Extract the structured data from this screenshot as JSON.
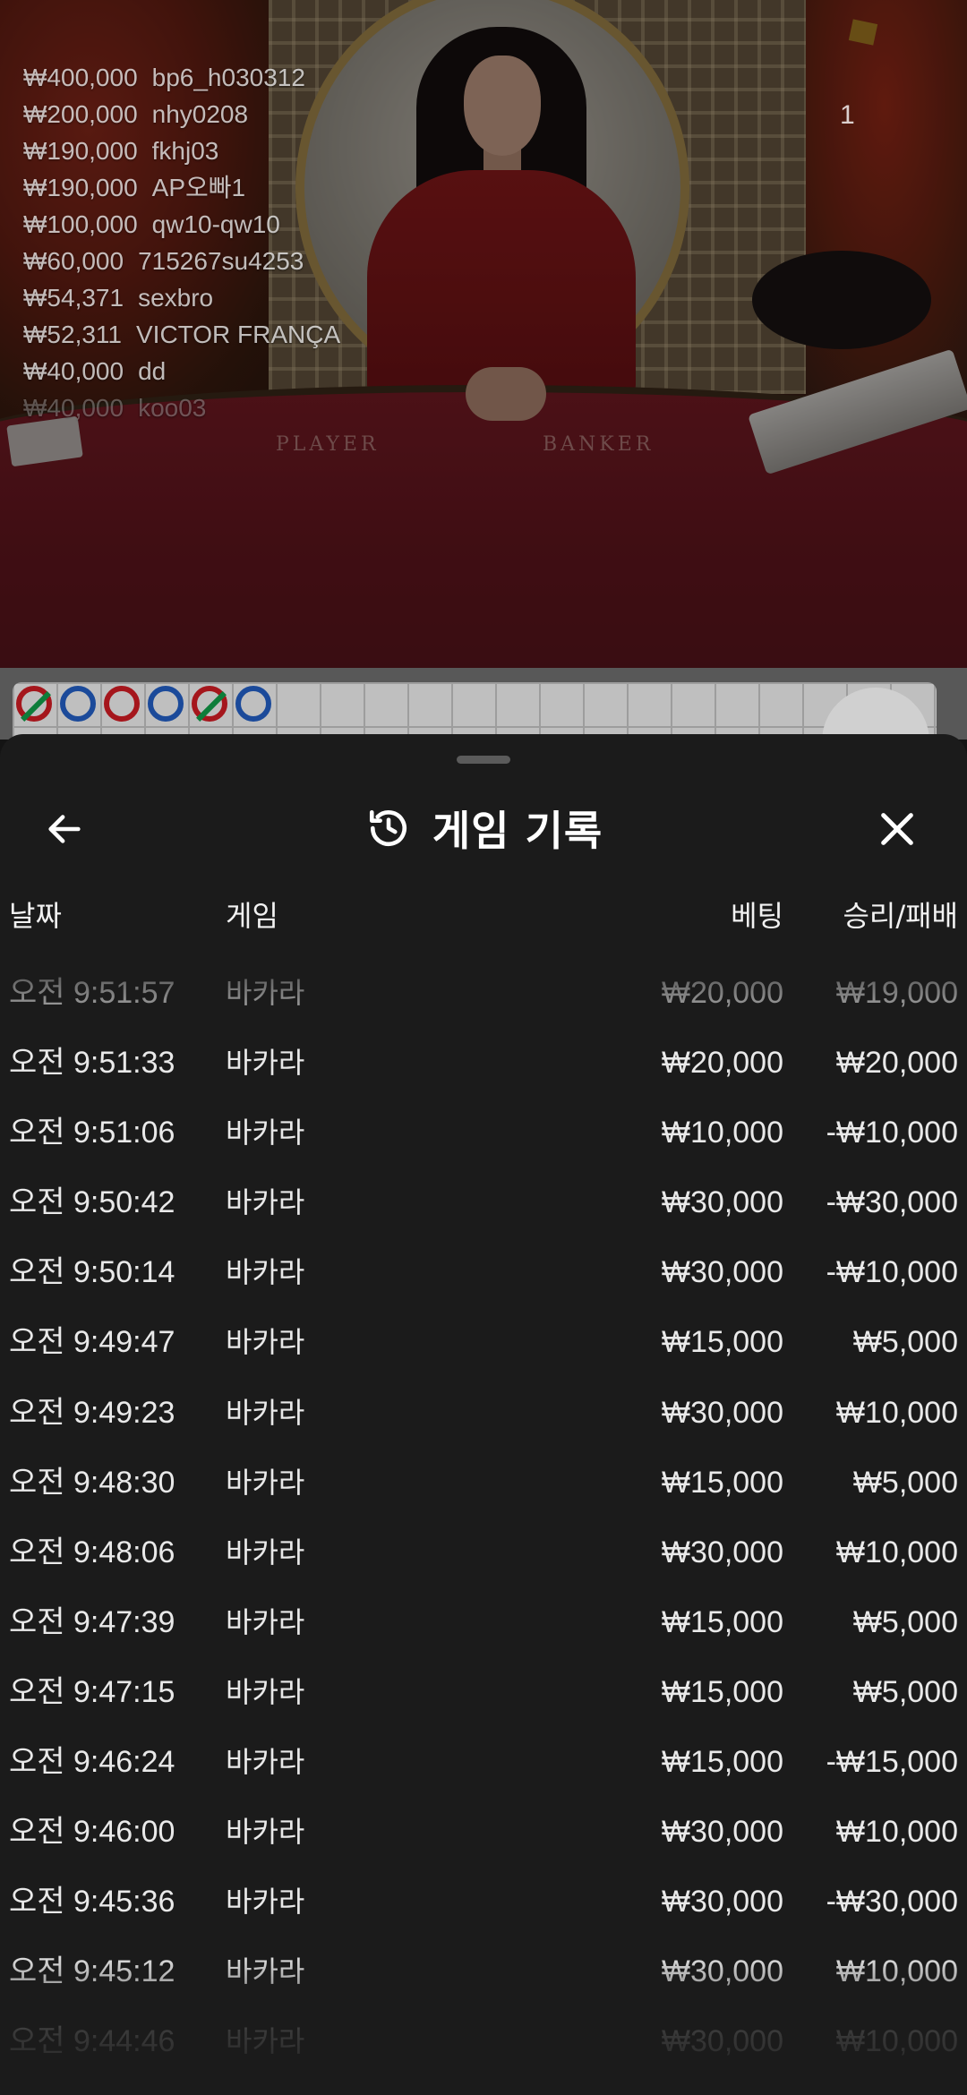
{
  "video": {
    "player_label": "PLAYER",
    "banker_label": "BANKER",
    "counter": "1",
    "top_winners": [
      {
        "amount": "₩400,000",
        "user": "bp6_h030312"
      },
      {
        "amount": "₩200,000",
        "user": "nhy0208"
      },
      {
        "amount": "₩190,000",
        "user": "fkhj03"
      },
      {
        "amount": "₩190,000",
        "user": "AP오빠1"
      },
      {
        "amount": "₩100,000",
        "user": "qw10-qw10"
      },
      {
        "amount": "₩60,000",
        "user": "715267su4253"
      },
      {
        "amount": "₩54,371",
        "user": "sexbro"
      },
      {
        "amount": "₩52,311",
        "user": "VICTOR FRANÇA"
      },
      {
        "amount": "₩40,000",
        "user": "dd"
      },
      {
        "amount": "₩40,000",
        "user": "koo03"
      }
    ]
  },
  "road": {
    "beads": [
      "red-tie",
      "blue",
      "red",
      "blue",
      "red-tie",
      "blue"
    ],
    "colors": {
      "red": "#a5161c",
      "blue": "#1b4a9a",
      "tie": "#0d7d3a"
    }
  },
  "sheet": {
    "title": "게임 기록",
    "back_icon": "arrow-left-icon",
    "history_icon": "history-icon",
    "close_icon": "close-icon",
    "columns": {
      "date": "날짜",
      "game": "게임",
      "bet": "베팅",
      "result": "승리/패배"
    },
    "rows": [
      {
        "date": "오전 9:51:57",
        "game": "바카라",
        "bet": "₩20,000",
        "result": "₩19,000"
      },
      {
        "date": "오전 9:51:33",
        "game": "바카라",
        "bet": "₩20,000",
        "result": "₩20,000"
      },
      {
        "date": "오전 9:51:06",
        "game": "바카라",
        "bet": "₩10,000",
        "result": "-₩10,000"
      },
      {
        "date": "오전 9:50:42",
        "game": "바카라",
        "bet": "₩30,000",
        "result": "-₩30,000"
      },
      {
        "date": "오전 9:50:14",
        "game": "바카라",
        "bet": "₩30,000",
        "result": "-₩10,000"
      },
      {
        "date": "오전 9:49:47",
        "game": "바카라",
        "bet": "₩15,000",
        "result": "₩5,000"
      },
      {
        "date": "오전 9:49:23",
        "game": "바카라",
        "bet": "₩30,000",
        "result": "₩10,000"
      },
      {
        "date": "오전 9:48:30",
        "game": "바카라",
        "bet": "₩15,000",
        "result": "₩5,000"
      },
      {
        "date": "오전 9:48:06",
        "game": "바카라",
        "bet": "₩30,000",
        "result": "₩10,000"
      },
      {
        "date": "오전 9:47:39",
        "game": "바카라",
        "bet": "₩15,000",
        "result": "₩5,000"
      },
      {
        "date": "오전 9:47:15",
        "game": "바카라",
        "bet": "₩15,000",
        "result": "₩5,000"
      },
      {
        "date": "오전 9:46:24",
        "game": "바카라",
        "bet": "₩15,000",
        "result": "-₩15,000"
      },
      {
        "date": "오전 9:46:00",
        "game": "바카라",
        "bet": "₩30,000",
        "result": "₩10,000"
      },
      {
        "date": "오전 9:45:36",
        "game": "바카라",
        "bet": "₩30,000",
        "result": "-₩30,000"
      },
      {
        "date": "오전 9:45:12",
        "game": "바카라",
        "bet": "₩30,000",
        "result": "₩10,000"
      },
      {
        "date": "오전 9:44:46",
        "game": "바카라",
        "bet": "₩30,000",
        "result": "₩10,000"
      }
    ]
  }
}
